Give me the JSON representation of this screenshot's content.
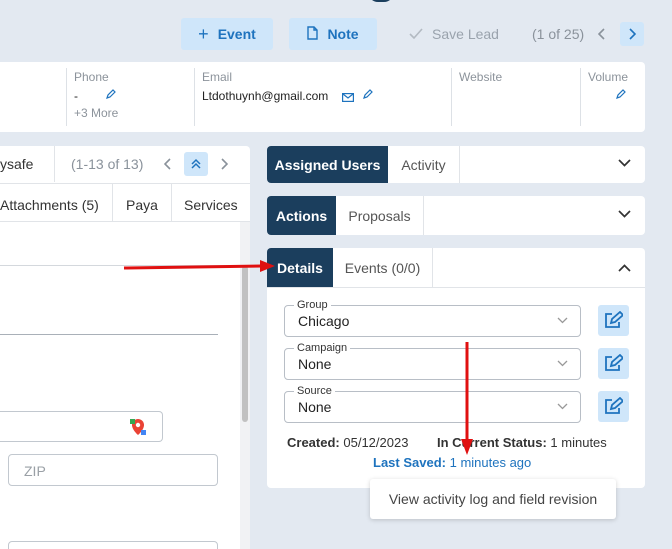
{
  "toolbar": {
    "event_label": "Event",
    "note_label": "Note",
    "save_lead_label": "Save Lead",
    "pager": "(1 of 25)"
  },
  "info": {
    "phone_label": "Phone",
    "phone_value": "-",
    "phone_more": "+3 More",
    "email_label": "Email",
    "email_value": "Ltdothuynh@gmail.com",
    "website_label": "Website",
    "volume_label": "Volume"
  },
  "left_panel": {
    "tab_partial": "ysafe",
    "pager": "(1-13 of 13)",
    "tabs": [
      "Attachments (5)",
      "Paya",
      "Services"
    ],
    "zip_placeholder": "ZIP"
  },
  "cards": {
    "assigned": {
      "active_tab": "Assigned Users",
      "tab2": "Activity"
    },
    "actions": {
      "active_tab": "Actions",
      "tab2": "Proposals"
    },
    "details": {
      "active_tab": "Details",
      "tab2": "Events (0/0)",
      "fields": [
        {
          "label": "Group",
          "value": "Chicago"
        },
        {
          "label": "Campaign",
          "value": "None"
        },
        {
          "label": "Source",
          "value": "None"
        }
      ],
      "created_label": "Created:",
      "created_value": "05/12/2023",
      "status_label": "In Current Status:",
      "status_value": "1 minutes",
      "last_saved_label": "Last Saved:",
      "last_saved_value": "1 minutes ago"
    }
  },
  "tooltip": "View activity log and field revision",
  "colors": {
    "accent": "#1e73be",
    "active_tab": "#1b3e5d",
    "light_button": "#cfe6fa",
    "annotation_arrow": "#e01010"
  }
}
